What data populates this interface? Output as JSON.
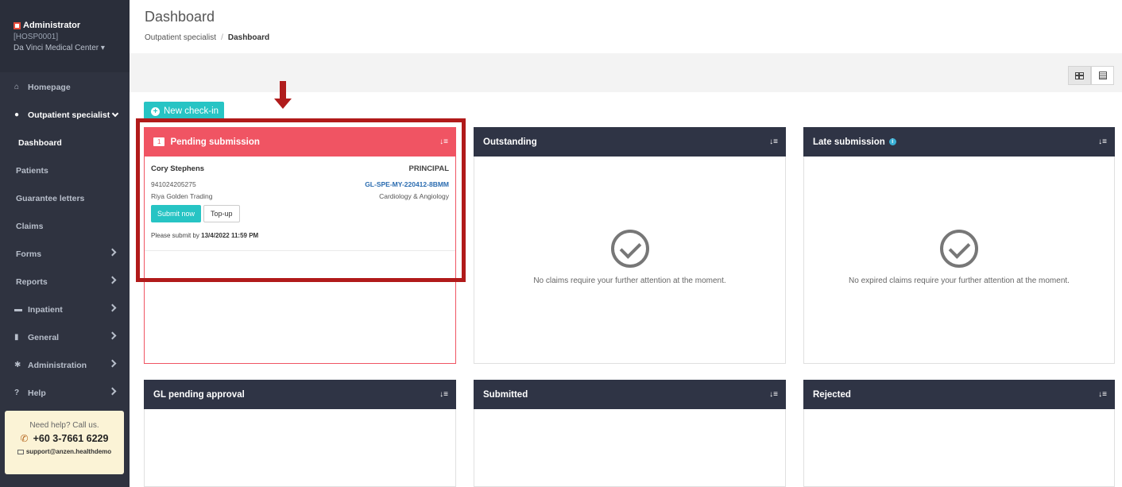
{
  "sidebar": {
    "user_role": "Administrator",
    "hospital_code": "[HOSP0001]",
    "center_name": "Da Vinci Medical Center",
    "nav": [
      {
        "label": "Homepage",
        "icon": "home-icon"
      },
      {
        "label": "Outpatient specialist",
        "icon": "user-icon"
      },
      {
        "label": "Dashboard"
      },
      {
        "label": "Patients"
      },
      {
        "label": "Guarantee letters"
      },
      {
        "label": "Claims"
      },
      {
        "label": "Forms"
      },
      {
        "label": "Reports"
      },
      {
        "label": "Inpatient",
        "icon": "bed-icon"
      },
      {
        "label": "General",
        "icon": "clipboard-icon"
      },
      {
        "label": "Administration",
        "icon": "gear-icon"
      },
      {
        "label": "Help",
        "icon": "question-icon"
      }
    ],
    "help": {
      "title": "Need help? Call us.",
      "phone": "+60 3-7661 6229",
      "email": "support@anzen.healthdemo"
    }
  },
  "header": {
    "title": "Dashboard",
    "breadcrumb": [
      "Outpatient specialist",
      "Dashboard"
    ]
  },
  "toolbar": {
    "new_checkin": "New check-in"
  },
  "panels": {
    "pending": {
      "title": "Pending submission",
      "count": "1",
      "claim": {
        "name": "Cory Stephens",
        "role": "PRINCIPAL",
        "id": "941024205275",
        "gl_number": "GL-SPE-MY-220412-8BMM",
        "company": "Riya Golden Trading",
        "department": "Cardiology & Angiology",
        "submit_label": "Submit now",
        "topup_label": "Top-up",
        "deadline_prefix": "Please submit by",
        "deadline": "13/4/2022 11:59 PM"
      }
    },
    "outstanding": {
      "title": "Outstanding",
      "empty_text": "No claims require your further attention at the moment."
    },
    "late": {
      "title": "Late submission",
      "empty_text": "No expired claims require your further attention at the moment."
    },
    "gl_pending": {
      "title": "GL pending approval"
    },
    "submitted": {
      "title": "Submitted"
    },
    "rejected": {
      "title": "Rejected"
    }
  },
  "colors": {
    "sidebar_bg": "#2f3340",
    "panel_header": "#2f3445",
    "pending_accent": "#f05463",
    "primary_button": "#27c4c4",
    "annotation_red": "#b11a1a"
  }
}
